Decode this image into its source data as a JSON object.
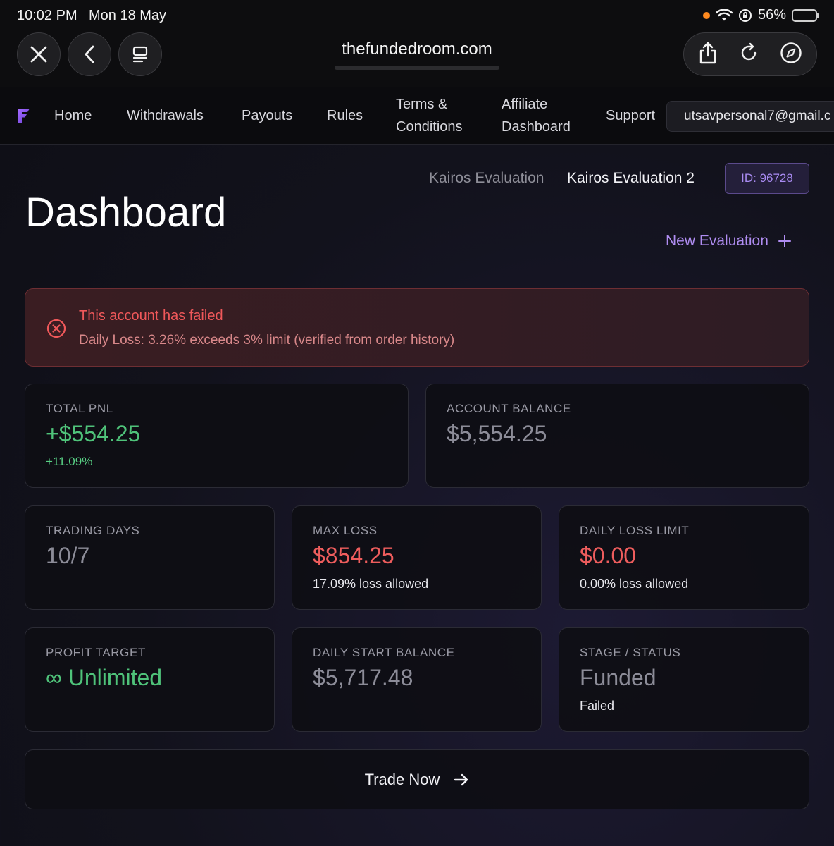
{
  "status_bar": {
    "time": "10:02 PM",
    "date": "Mon 18 May",
    "battery": "56%",
    "battery_level": 0.56
  },
  "browser": {
    "url": "thefundedroom.com",
    "icons": [
      "close-icon",
      "back-icon",
      "tabs-icon",
      "share-icon",
      "reload-icon",
      "compass-icon"
    ]
  },
  "nav": {
    "items": [
      {
        "label": "Home"
      },
      {
        "label": "Withdrawals"
      },
      {
        "label": "Payouts"
      },
      {
        "label": "Rules"
      },
      {
        "label_line1": "Terms &",
        "label_line2": "Conditions"
      },
      {
        "label_line1": "Affiliate",
        "label_line2": "Dashboard"
      },
      {
        "label": "Support"
      }
    ],
    "email": "utsavpersonal7@gmail.c"
  },
  "header": {
    "title": "Dashboard",
    "eval_tabs": [
      "Kairos Evaluation",
      "Kairos Evaluation 2"
    ],
    "id_badge": "ID: 96728",
    "new_eval": "New Evaluation",
    "new_eval_icon": "plus-icon"
  },
  "alert": {
    "icon": "x-circle-icon",
    "title": "This account has failed",
    "detail": "Daily Loss: 3.26% exceeds 3% limit (verified from order history)"
  },
  "cards": {
    "total_pnl": {
      "label": "TOTAL PNL",
      "value": "+$554.25",
      "sub": "+11.09%"
    },
    "account_balance": {
      "label": "ACCOUNT BALANCE",
      "value": "$5,554.25"
    },
    "trading_days": {
      "label": "TRADING DAYS",
      "value": "10/7"
    },
    "max_loss": {
      "label": "MAX LOSS",
      "value": "$854.25",
      "sub": "17.09% loss allowed"
    },
    "daily_loss_limit": {
      "label": "DAILY LOSS LIMIT",
      "value": "$0.00",
      "sub": "0.00% loss allowed"
    },
    "profit_target": {
      "label": "PROFIT TARGET",
      "value": "∞ Unlimited"
    },
    "daily_start_balance": {
      "label": "DAILY START BALANCE",
      "value": "$5,717.48"
    },
    "stage_status": {
      "label": "STAGE / STATUS",
      "value": "Funded",
      "sub": "Failed"
    }
  },
  "trade_button": {
    "label": "Trade Now",
    "icon": "arrow-right-icon"
  },
  "colors": {
    "accent_purple": "#b08df2",
    "success_green": "#4fc37a",
    "danger_red": "#ee5d5d",
    "alert_bg": "#3a1d22"
  }
}
